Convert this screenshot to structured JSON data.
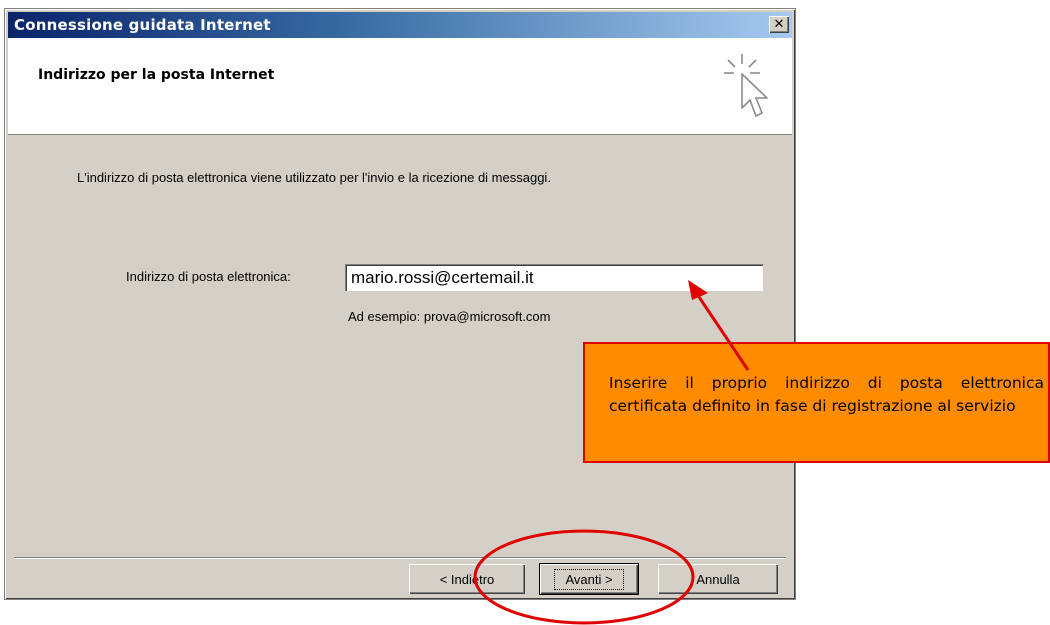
{
  "window": {
    "title": "Connessione guidata Internet",
    "close_label": "x"
  },
  "header": {
    "heading": "Indirizzo per la posta Internet"
  },
  "body": {
    "intro": "L'indirizzo di posta elettronica viene utilizzato per l'invio e la ricezione di messaggi.",
    "email_label": "Indirizzo di posta elettronica:",
    "email_value": "mario.rossi@certemail.it",
    "example": "Ad esempio: prova@microsoft.com"
  },
  "buttons": {
    "back": "< Indietro",
    "next": "Avanti >",
    "cancel": "Annulla"
  },
  "annotation": {
    "callout_text": "Inserire il proprio indirizzo di posta elettronica certificata definito in fase di registrazione al servizio",
    "callout_color": "#ff8c00",
    "callout_border": "#e00000",
    "arrow_color": "#e00000"
  }
}
